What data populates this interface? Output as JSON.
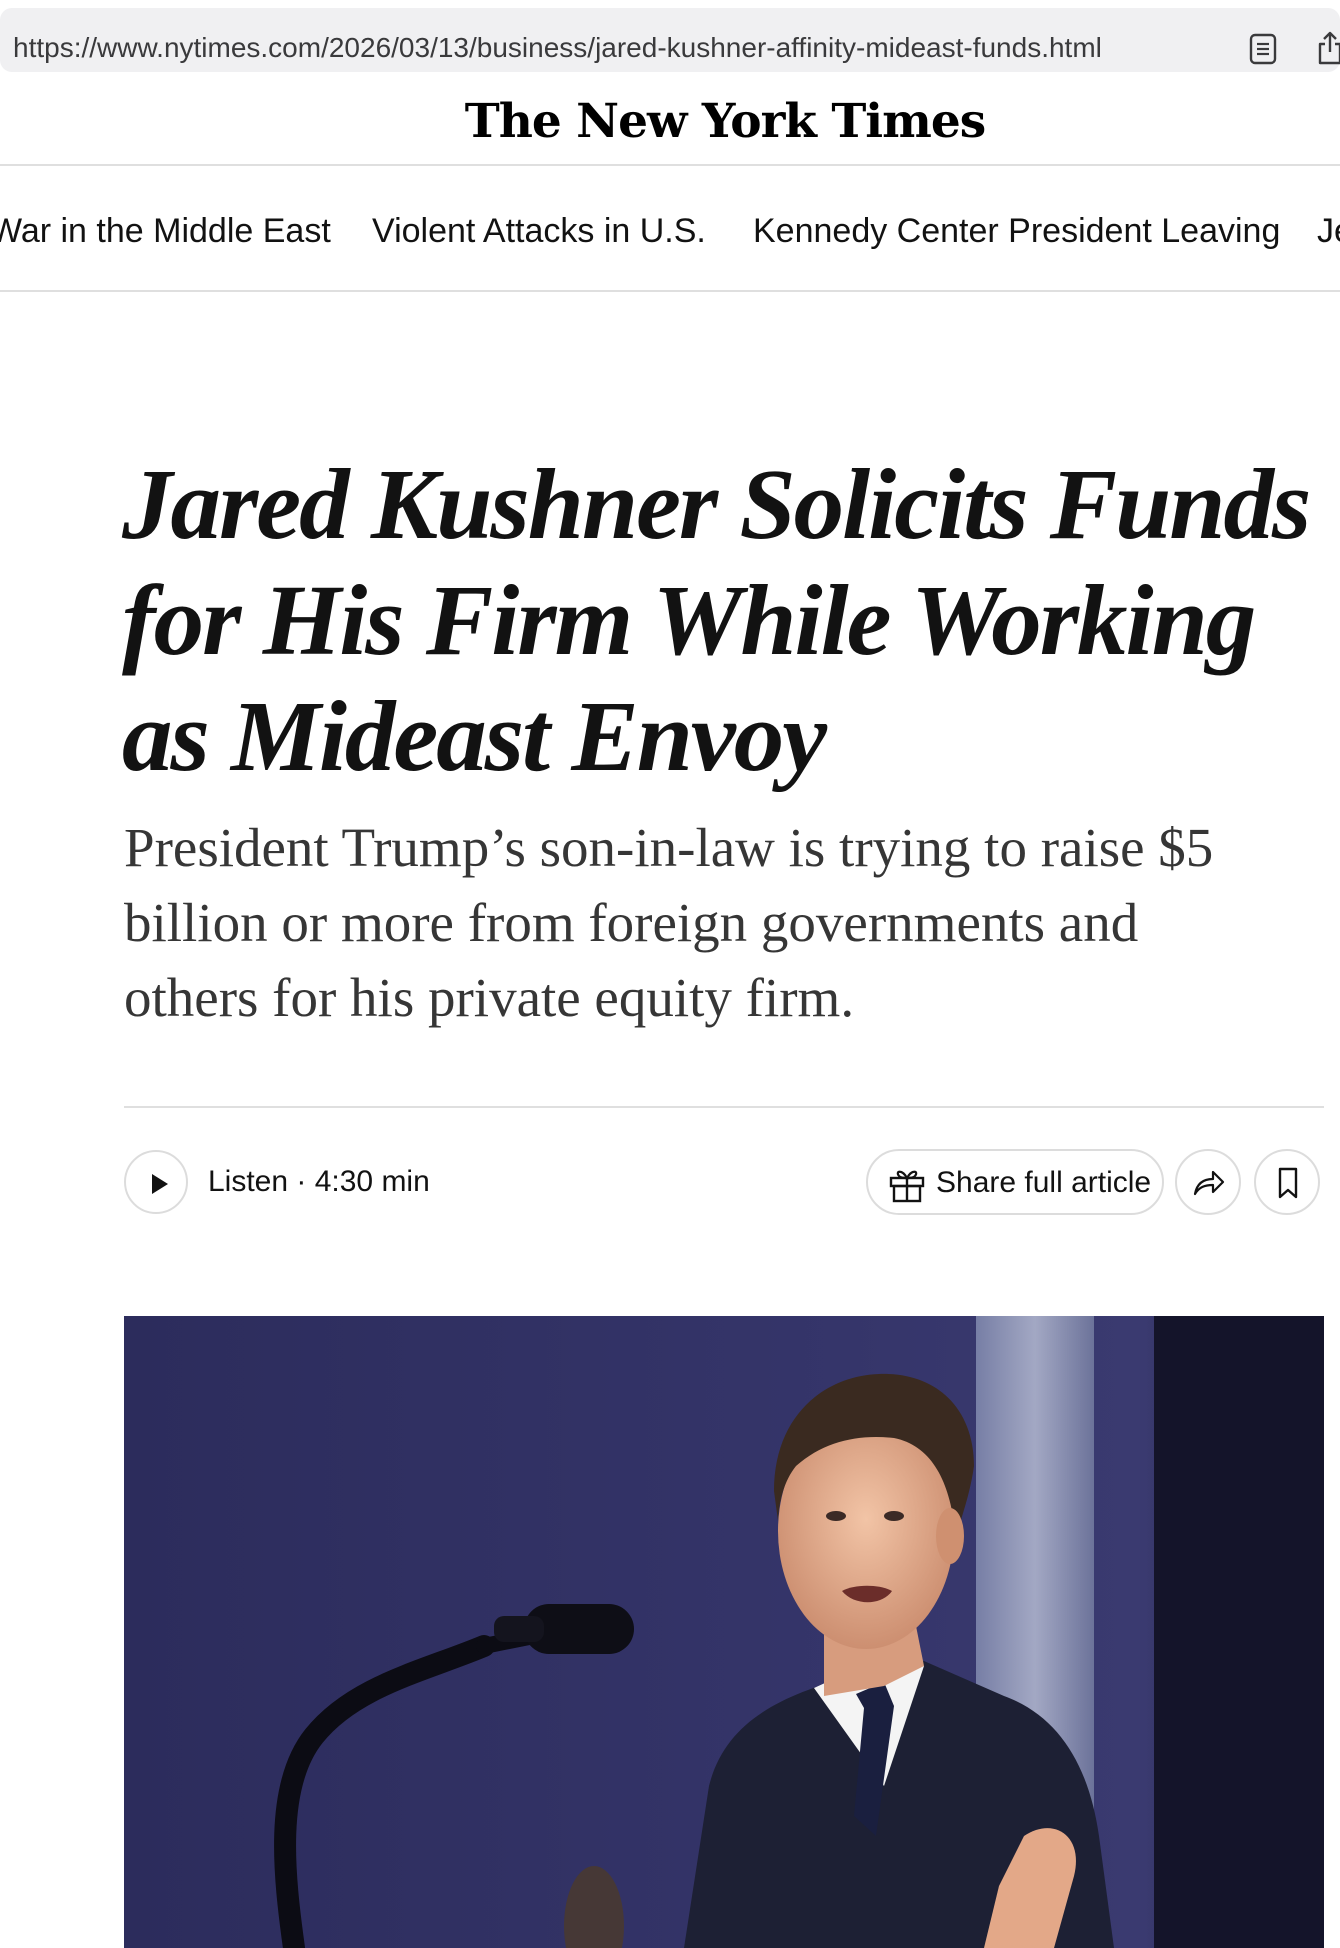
{
  "browser": {
    "url": "https://www.nytimes.com/2026/03/13/business/jared-kushner-affinity-mideast-funds.html",
    "reader_icon": "reader-view-icon",
    "share_icon": "share-icon"
  },
  "masthead": {
    "logo_text": "The New York Times"
  },
  "nav": {
    "items": [
      "War in the Middle East",
      "Violent Attacks in U.S.",
      "Kennedy Center President Leaving",
      "Je"
    ]
  },
  "article": {
    "headline": "Jared Kushner Solicits Funds for His Firm While Working as Mideast Envoy",
    "summary": "President Trump’s son-in-law is trying to raise $5 billion or more from foreign governments and others for his private equity firm."
  },
  "toolbar": {
    "listen_label": "Listen · 4:30 min",
    "share_full_label": "Share full article",
    "icons": [
      "play-icon",
      "gift-icon",
      "share-arrow-icon",
      "bookmark-icon"
    ]
  },
  "lead_image": {
    "alt_description_icon": "photo"
  }
}
